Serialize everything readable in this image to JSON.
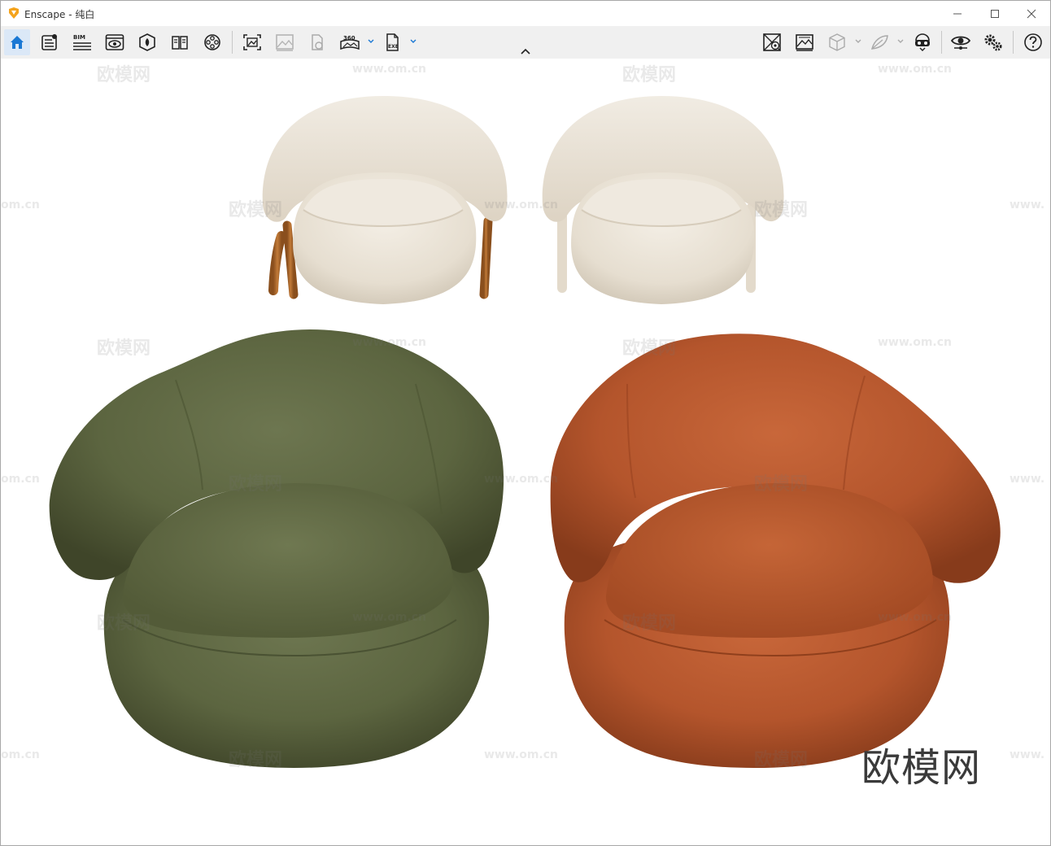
{
  "window": {
    "app_name": "Enscape",
    "title_separator": " - ",
    "scene_name": "纯白"
  },
  "toolbar": {
    "bim_label": "BIM",
    "panorama_label": "360",
    "exe_label": "EXE",
    "accent_color": "#1a78d4",
    "left_icons": [
      "home-icon",
      "asset-library-icon",
      "bim-icon",
      "view-management-icon",
      "visual-settings-icon",
      "atmosphere-icon",
      "material-editor-icon",
      "batch-render-icon",
      "screenshot-icon",
      "panorama-icon",
      "exe-export-icon"
    ],
    "right_icons": [
      "site-context-icon",
      "capture-icon",
      "views-icon",
      "vegetation-icon",
      "vr-headset-icon",
      "visibility-icon",
      "settings-icon",
      "help-icon"
    ]
  },
  "watermarks": {
    "site_cn": "欧模网",
    "site_url": "www.om.cn",
    "site_url_partial_left": "om.cn",
    "site_url_partial_right": "www.",
    "brand": "欧模网"
  },
  "scene": {
    "armchairs": [
      {
        "name": "cream armchair with wood legs",
        "color": "#e9e2d6"
      },
      {
        "name": "cream armchair",
        "color": "#ebe5da"
      },
      {
        "name": "olive lounge chair",
        "color": "#5e6742"
      },
      {
        "name": "terracotta lounge chair",
        "color": "#b8582f"
      }
    ]
  }
}
